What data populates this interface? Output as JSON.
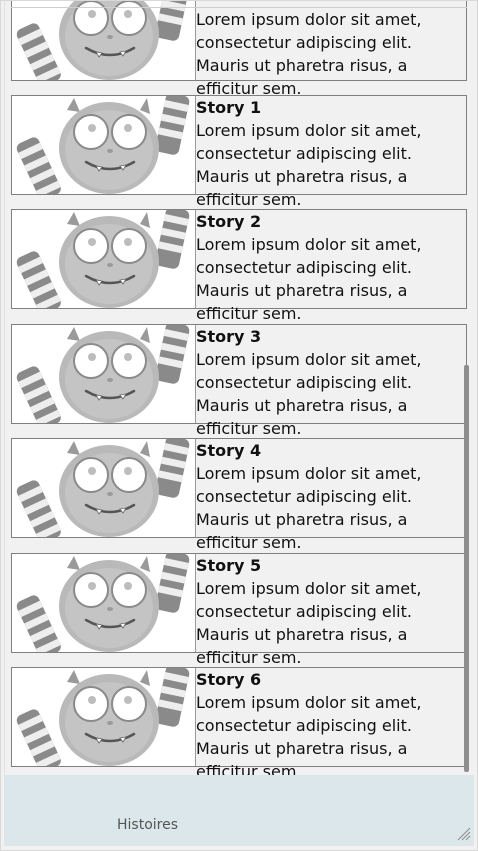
{
  "stories": [
    {
      "title": "",
      "body": "Lorem ipsum dolor sit amet, consectetur adipiscing elit. Mauris ut pharetra risus, a efficitur sem."
    },
    {
      "title": "Story 1",
      "body": "Lorem ipsum dolor sit amet, consectetur adipiscing elit. Mauris ut pharetra risus, a efficitur sem."
    },
    {
      "title": "Story 2",
      "body": "Lorem ipsum dolor sit amet, consectetur adipiscing elit. Mauris ut pharetra risus, a efficitur sem."
    },
    {
      "title": "Story 3",
      "body": "Lorem ipsum dolor sit amet, consectetur adipiscing elit. Mauris ut pharetra risus, a efficitur sem."
    },
    {
      "title": "Story 4",
      "body": "Lorem ipsum dolor sit amet, consectetur adipiscing elit. Mauris ut pharetra risus, a efficitur sem."
    },
    {
      "title": "Story 5",
      "body": "Lorem ipsum dolor sit amet, consectetur adipiscing elit. Mauris ut pharetra risus, a efficitur sem."
    },
    {
      "title": "Story 6",
      "body": "Lorem ipsum dolor sit amet, consectetur adipiscing elit. Mauris ut pharetra risus, a efficitur sem."
    }
  ],
  "bottom_bar": {
    "tab_label": "Histoires"
  },
  "icons": {
    "thumbnail": "monster-icon",
    "resize": "resize-grip-icon"
  }
}
